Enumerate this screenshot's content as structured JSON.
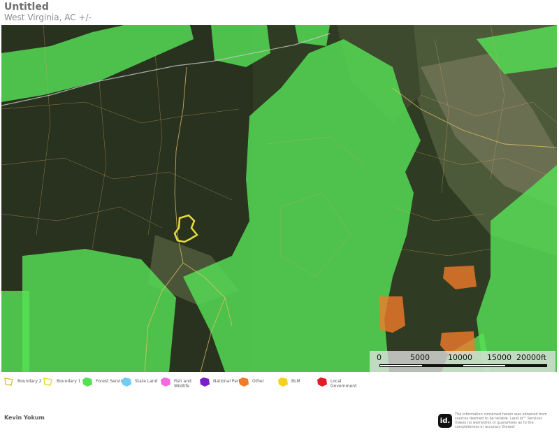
{
  "header": {
    "title": "Untitled",
    "subtitle": "West Virginia,  AC +/-"
  },
  "scale_bar": {
    "labels": [
      "0",
      "5000",
      "10000",
      "15000",
      "20000ft"
    ]
  },
  "legend": {
    "items": [
      {
        "label": "Boundary 2",
        "color": "#d6c84a",
        "type": "outline"
      },
      {
        "label": "Boundary 1",
        "color": "#e6dd3a",
        "type": "outline"
      },
      {
        "label": "Forest Servic",
        "color": "#55e055",
        "type": "fill"
      },
      {
        "label": "State Land",
        "color": "#6fcdf2",
        "type": "fill"
      },
      {
        "label": "Fish and Wildlife",
        "color": "#f06ce0",
        "type": "fill"
      },
      {
        "label": "National Park",
        "color": "#7a1ec8",
        "type": "fill"
      },
      {
        "label": "Other",
        "color": "#f07a2a",
        "type": "fill"
      },
      {
        "label": "BLM",
        "color": "#f2d21c",
        "type": "fill"
      },
      {
        "label": "Local Government",
        "color": "#e01e2a",
        "type": "fill"
      }
    ]
  },
  "footer": {
    "author": "Kevin Yokum",
    "logo_text": "id.",
    "disclaimer": "The information contained herein was obtained from sources deemed to be reliable. Land id™ Services makes no warranties or guarantees as to the completeness or accuracy thereof."
  }
}
